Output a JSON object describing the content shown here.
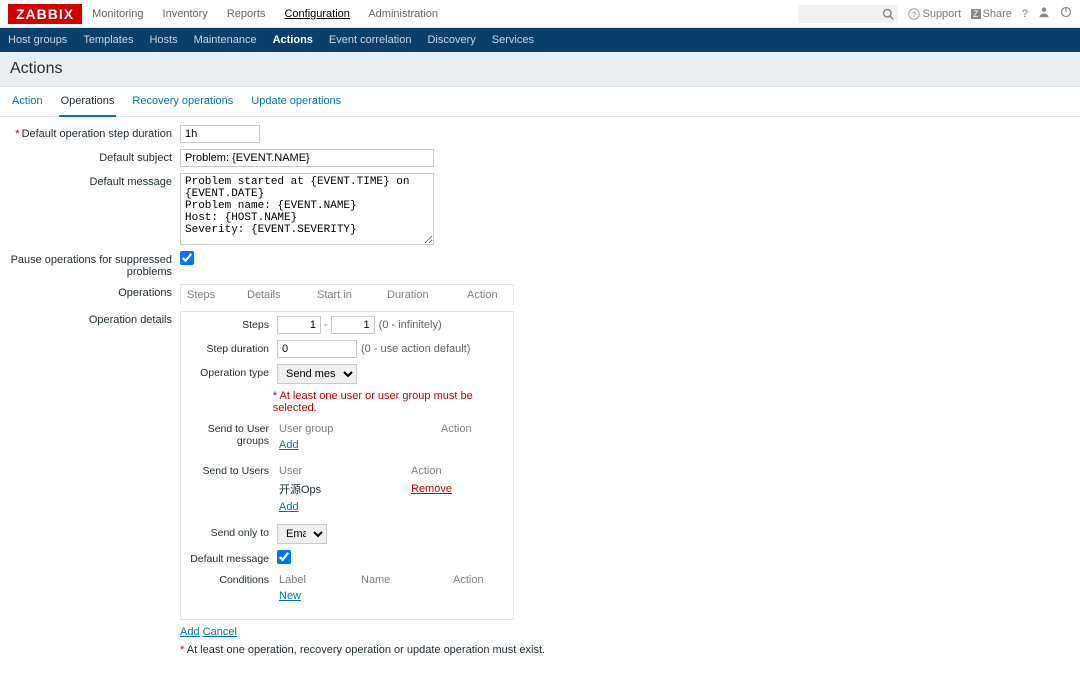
{
  "brand": "ZABBIX",
  "topnav": {
    "items": [
      "Monitoring",
      "Inventory",
      "Reports",
      "Configuration",
      "Administration"
    ],
    "active": 3,
    "support": "Support",
    "share": "Share"
  },
  "subnav": {
    "items": [
      "Host groups",
      "Templates",
      "Hosts",
      "Maintenance",
      "Actions",
      "Event correlation",
      "Discovery",
      "Services"
    ],
    "active": 4
  },
  "page_title": "Actions",
  "tabs": {
    "items": [
      "Action",
      "Operations",
      "Recovery operations",
      "Update operations"
    ],
    "active": 1
  },
  "form": {
    "default_step_label": "Default operation step duration",
    "default_step_value": "1h",
    "default_subject_label": "Default subject",
    "default_subject_value": "Problem: {EVENT.NAME}",
    "default_message_label": "Default message",
    "default_message_value": "Problem started at {EVENT.TIME} on {EVENT.DATE}\nProblem name: {EVENT.NAME}\nHost: {HOST.NAME}\nSeverity: {EVENT.SEVERITY}\n\nOriginal problem ID: {EVENT.ID}\n{TRIGGER.URL}",
    "pause_label": "Pause operations for suppressed problems",
    "pause_checked": true,
    "operations_label": "Operations",
    "ops_cols": {
      "steps": "Steps",
      "details": "Details",
      "start": "Start in",
      "duration": "Duration",
      "action": "Action"
    },
    "operation_details_label": "Operation details",
    "details": {
      "steps_label": "Steps",
      "step_from": "1",
      "step_to": "1",
      "steps_hint": "(0 - infinitely)",
      "step_duration_label": "Step duration",
      "step_duration_value": "0",
      "step_duration_hint": "(0 - use action default)",
      "op_type_label": "Operation type",
      "op_type_value": "Send message",
      "validation": "At least one user or user group must be selected.",
      "send_ug_label": "Send to User groups",
      "ug_col": "User group",
      "action_col": "Action",
      "add": "Add",
      "send_users_label": "Send to Users",
      "user_col": "User",
      "user_row": "开源Ops",
      "remove": "Remove",
      "send_only_label": "Send only to",
      "send_only_value": "Email",
      "default_msg_label": "Default message",
      "default_msg_checked": true,
      "conditions_label": "Conditions",
      "cond_label": "Label",
      "cond_name": "Name",
      "cond_action": "Action",
      "new": "New"
    },
    "add": "Add",
    "cancel": "Cancel",
    "footnote": "At least one operation, recovery operation or update operation must exist."
  }
}
